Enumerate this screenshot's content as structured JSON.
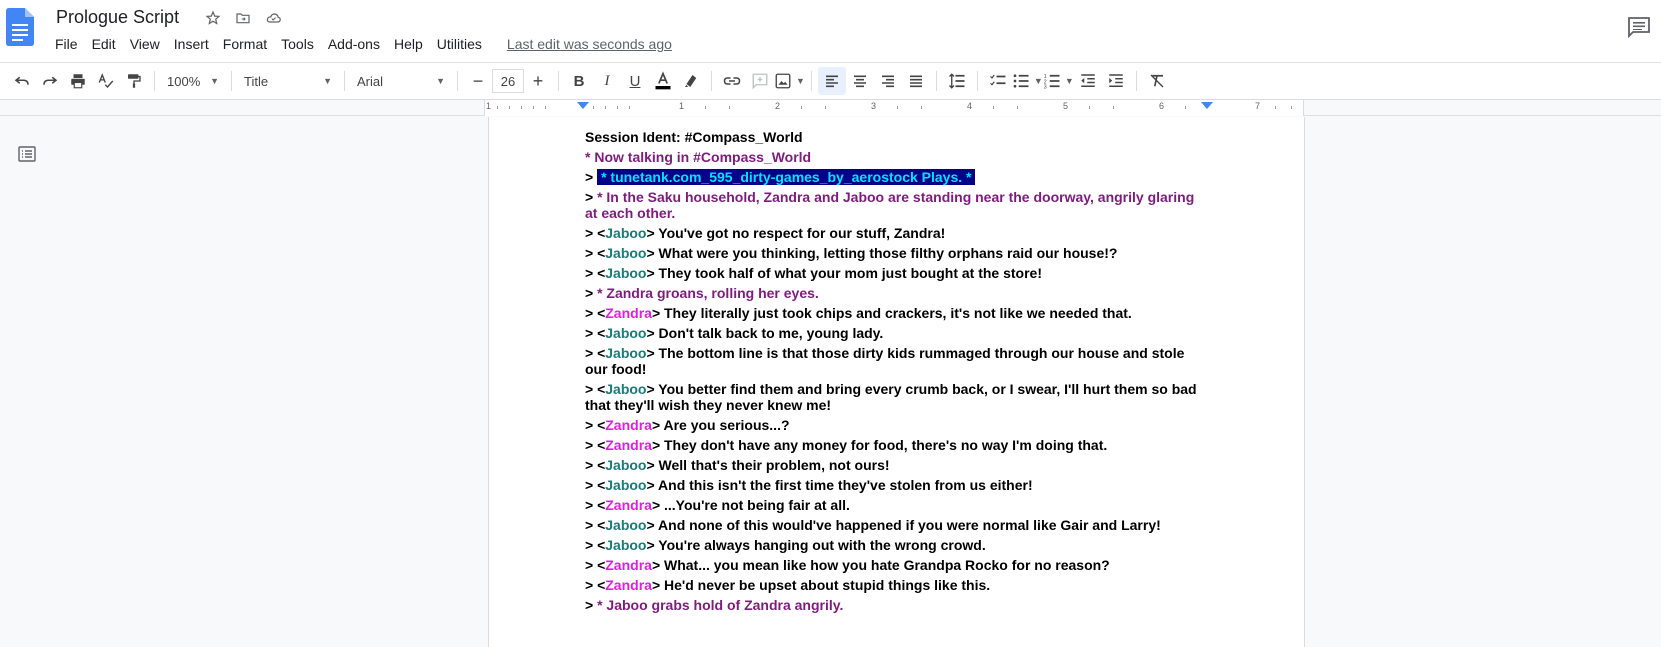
{
  "app": {
    "title": "Prologue Script",
    "last_edit": "Last edit was seconds ago",
    "menu": [
      "File",
      "Edit",
      "View",
      "Insert",
      "Format",
      "Tools",
      "Add-ons",
      "Help",
      "Utilities"
    ]
  },
  "toolbar": {
    "zoom": "100%",
    "style": "Title",
    "font": "Arial",
    "font_size": "26"
  },
  "ruler": {
    "numbers": [
      "1",
      "1",
      "2",
      "3",
      "4",
      "5",
      "6",
      "7"
    ]
  },
  "colors": {
    "jaboo": "#1a7a7a",
    "zandra": "#e01ee0",
    "action": "#7d1c7d",
    "highlight_bg": "#00008b",
    "highlight_fg": "#00e5ff",
    "accent": "#4285f4"
  },
  "doc": {
    "lines": [
      {
        "prefix": "",
        "speaker": "",
        "text": "Session Ident: #Compass_World",
        "kind": "plain"
      },
      {
        "prefix": "",
        "speaker": "",
        "text": "* Now talking in #Compass_World",
        "kind": "action"
      },
      {
        "prefix": "> ",
        "speaker": "",
        "text": "* tunetank.com_595_dirty-games_by_aerostock Plays. *",
        "kind": "highlight"
      },
      {
        "prefix": "> ",
        "speaker": "",
        "text": "* In the Saku household, Zandra and Jaboo are standing near the doorway, angrily glaring at each other.",
        "kind": "action"
      },
      {
        "prefix": "> <",
        "speaker": "Jaboo",
        "text": "> You've got no respect for our stuff, Zandra!",
        "kind": "jab"
      },
      {
        "prefix": "> <",
        "speaker": "Jaboo",
        "text": "> What were you thinking, letting those filthy orphans raid our house!?",
        "kind": "jab"
      },
      {
        "prefix": "> <",
        "speaker": "Jaboo",
        "text": "> They took half of what your mom just bought at the store!",
        "kind": "jab"
      },
      {
        "prefix": "> ",
        "speaker": "",
        "text": "* Zandra groans, rolling her eyes.",
        "kind": "action"
      },
      {
        "prefix": "> <",
        "speaker": "Zandra",
        "text": "> They literally just took chips and crackers, it's not like we needed that.",
        "kind": "zan"
      },
      {
        "prefix": "> <",
        "speaker": "Jaboo",
        "text": "> Don't talk back to me, young lady.",
        "kind": "jab"
      },
      {
        "prefix": "> <",
        "speaker": "Jaboo",
        "text": "> The bottom line is that those dirty kids rummaged through our house and stole our food!",
        "kind": "jab"
      },
      {
        "prefix": "> <",
        "speaker": "Jaboo",
        "text": "> You better find them and bring every crumb back, or I swear, I'll hurt them so bad that they'll wish they never knew me!",
        "kind": "jab"
      },
      {
        "prefix": "> <",
        "speaker": "Zandra",
        "text": "> Are you serious...?",
        "kind": "zan"
      },
      {
        "prefix": "> <",
        "speaker": "Zandra",
        "text": "> They don't have any money for food, there's no way I'm doing that.",
        "kind": "zan"
      },
      {
        "prefix": "> <",
        "speaker": "Jaboo",
        "text": "> Well that's their problem, not ours!",
        "kind": "jab"
      },
      {
        "prefix": "> <",
        "speaker": "Jaboo",
        "text": "> And this isn't the first time they've stolen from us either!",
        "kind": "jab"
      },
      {
        "prefix": "> <",
        "speaker": "Zandra",
        "text": "> ...You're not being fair at all.",
        "kind": "zan"
      },
      {
        "prefix": "> <",
        "speaker": "Jaboo",
        "text": "> And none of this would've happened if you were normal like Gair and Larry!",
        "kind": "jab"
      },
      {
        "prefix": "> <",
        "speaker": "Jaboo",
        "text": "> You're always hanging out with the wrong crowd.",
        "kind": "jab"
      },
      {
        "prefix": "> <",
        "speaker": "Zandra",
        "text": "> What... you mean like how you hate Grandpa Rocko for no reason?",
        "kind": "zan"
      },
      {
        "prefix": "> <",
        "speaker": "Zandra",
        "text": "> He'd never be upset about stupid things like this.",
        "kind": "zan"
      },
      {
        "prefix": "> ",
        "speaker": "",
        "text": "* Jaboo grabs hold of Zandra angrily.",
        "kind": "action"
      }
    ]
  }
}
